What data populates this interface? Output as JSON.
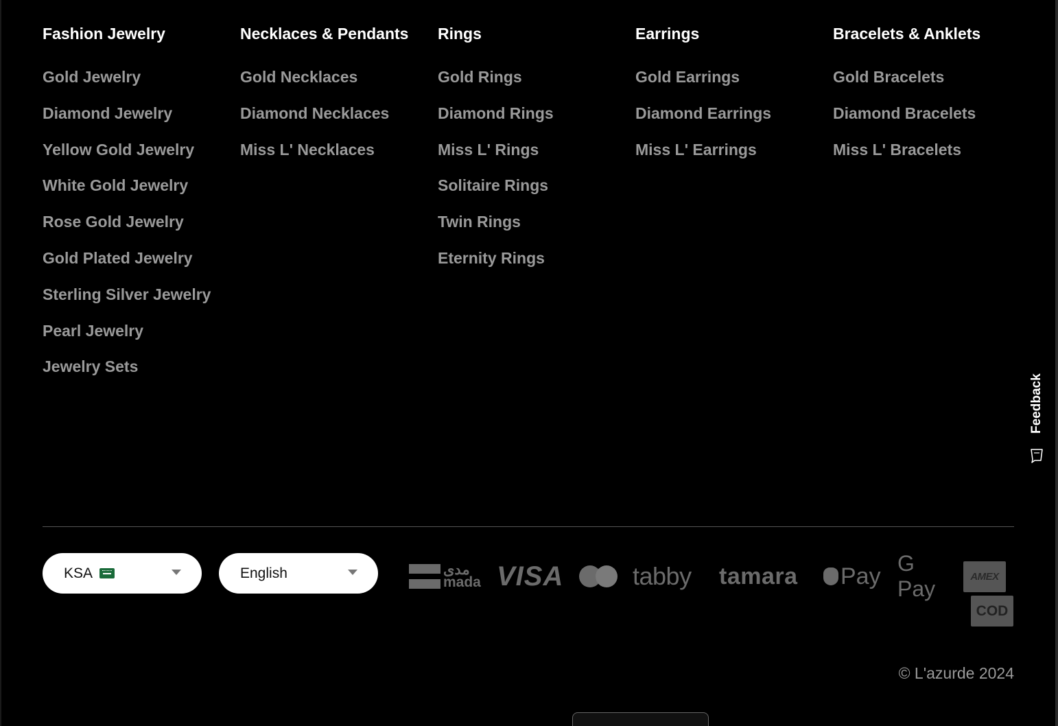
{
  "columns": [
    {
      "title": "Fashion Jewelry",
      "links": [
        "Gold Jewelry",
        "Diamond Jewelry",
        "Yellow Gold Jewelry",
        "White Gold Jewelry",
        "Rose Gold Jewelry",
        "Gold Plated Jewelry",
        "Sterling Silver Jewelry",
        "Pearl Jewelry",
        "Jewelry Sets"
      ]
    },
    {
      "title": "Necklaces & Pendants",
      "links": [
        "Gold Necklaces",
        "Diamond Necklaces",
        "Miss L' Necklaces"
      ]
    },
    {
      "title": "Rings",
      "links": [
        "Gold Rings",
        "Diamond Rings",
        "Miss L' Rings",
        "Solitaire Rings",
        "Twin Rings",
        "Eternity Rings"
      ]
    },
    {
      "title": "Earrings",
      "links": [
        "Gold Earrings",
        "Diamond Earrings",
        "Miss L' Earrings"
      ]
    },
    {
      "title": "Bracelets & Anklets",
      "links": [
        "Gold Bracelets",
        "Diamond Bracelets",
        "Miss L' Bracelets"
      ]
    }
  ],
  "country_select": {
    "value": "KSA",
    "flag_icon": "saudi-flag-icon",
    "caret_icon": "caret-down-icon"
  },
  "language_select": {
    "value": "English",
    "caret_icon": "caret-down-icon"
  },
  "payment_methods": {
    "mada_arabic": "مدى",
    "mada_latin": "mada",
    "visa": "VISA",
    "mastercard_icon": "mastercard-icon",
    "tabby": "tabby",
    "tamara": "tamara",
    "apple_pay": "Pay",
    "google_pay": "G Pay",
    "amex": "AMEX",
    "cod": "COD"
  },
  "copyright": "© L'azurde 2024",
  "feedback": {
    "label": "Feedback",
    "icon": "feedback-icon"
  },
  "colors": {
    "background": "#000000",
    "heading": "#ffffff",
    "link": "#9a9a9a",
    "payment_logo": "#6b6b6b"
  }
}
